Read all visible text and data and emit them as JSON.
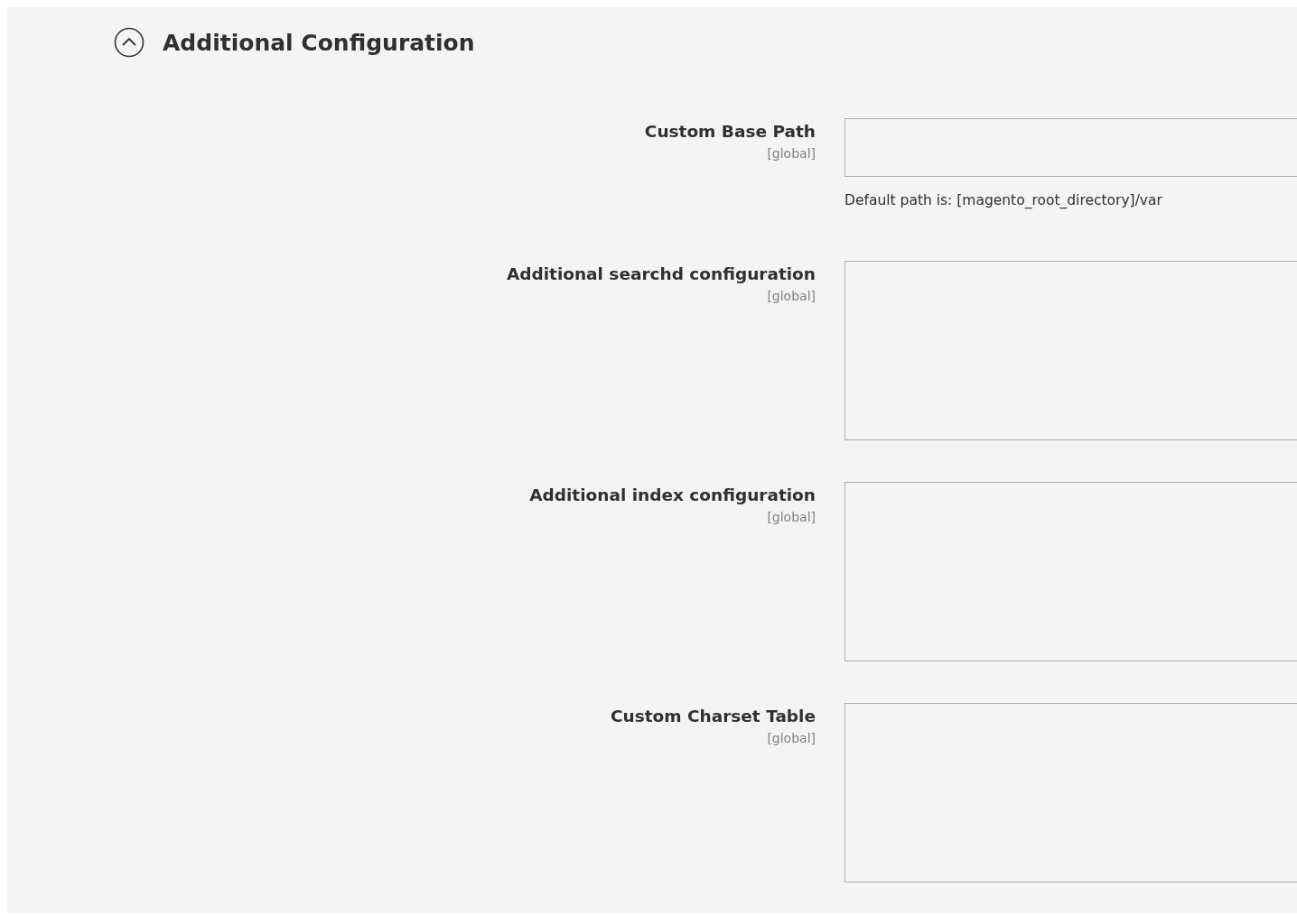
{
  "section": {
    "title": "Additional Configuration",
    "expanded": true
  },
  "fields": [
    {
      "kind": "input",
      "label": "Custom Base Path",
      "scope": "[global]",
      "note": "Default path is: [magento_root_directory]/var"
    },
    {
      "kind": "textarea",
      "label": "Additional searchd configuration",
      "scope": "[global]"
    },
    {
      "kind": "textarea",
      "label": "Additional index configuration",
      "scope": "[global]"
    },
    {
      "kind": "textarea",
      "label": "Custom Charset Table",
      "scope": "[global]"
    }
  ]
}
